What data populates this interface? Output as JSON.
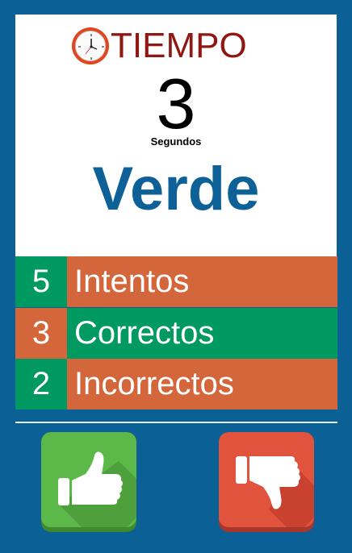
{
  "timer": {
    "label": "TIEMPO",
    "seconds": "3",
    "unit": "Segundos",
    "icon": "clock-icon"
  },
  "word": "Verde",
  "stats": [
    {
      "count": "5",
      "label": "Intentos"
    },
    {
      "count": "3",
      "label": "Correctos"
    },
    {
      "count": "2",
      "label": "Incorrectos"
    }
  ],
  "buttons": {
    "like_icon": "thumbs-up-icon",
    "dislike_icon": "thumbs-down-icon"
  },
  "colors": {
    "background": "#0b6196",
    "word": "#0d6197",
    "timer_label": "#8f1714",
    "green": "#019962",
    "orange": "#d3663a",
    "like_button": "#5cb848",
    "dislike_button": "#e2533e"
  }
}
